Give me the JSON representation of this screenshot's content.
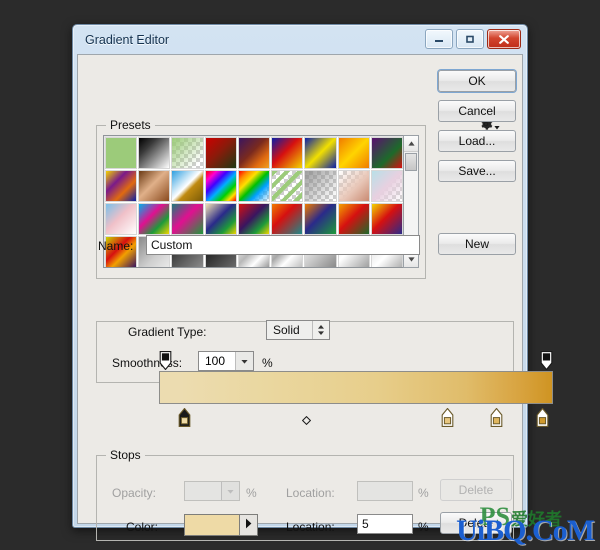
{
  "window": {
    "title": "Gradient Editor",
    "buttons": {
      "minimize": "minimize-button",
      "maximize": "maximize-button",
      "close": "close-button"
    }
  },
  "presets": {
    "legend": "Presets",
    "gear_icon": "gear-icon",
    "scroll": {
      "up": "scroll-up-arrow",
      "down": "scroll-down-arrow"
    },
    "columns": 9,
    "swatches": [
      {
        "name": "green-solid",
        "css": "linear-gradient(135deg,#9ccb7a,#9ccb7a)"
      },
      {
        "name": "black-white",
        "css": "linear-gradient(135deg,#000000 0%,#3a3a3a 30%,#ffffff 100%)"
      },
      {
        "name": "green-transparent",
        "css": "linear-gradient(135deg,#9ccb7a 0%,rgba(156,203,122,0) 85%)",
        "checker": true
      },
      {
        "name": "red-dark-green",
        "css": "linear-gradient(135deg,#cc0000 0%,#8c1a0a 45%,#1d3a14 100%)"
      },
      {
        "name": "purple-orange",
        "css": "linear-gradient(135deg,#3a1560 0%,#7a2a1e 45%,#e06a10 75%,#f0a020 100%)"
      },
      {
        "name": "blue-red-yellow",
        "css": "linear-gradient(135deg,#0a1fa8 0%,#d61010 45%,#f2d400 100%)"
      },
      {
        "name": "blue-yellow",
        "css": "linear-gradient(135deg,#0a1fa8 0%,#f2e000 50%,#0a1fa8 100%)"
      },
      {
        "name": "orange-yellow",
        "css": "linear-gradient(135deg,#f07b00 0%,#ffd400 50%,#f07b00 100%)"
      },
      {
        "name": "purple-green",
        "css": "linear-gradient(135deg,#5a1070 0%,#1d6a2a 60%,#d61010 100%)"
      },
      {
        "name": "yellow-purple-orange",
        "css": "linear-gradient(135deg,#f2d400 0%,#7a1a8a 35%,#e06a10 65%,#0a1fa8 100%)"
      },
      {
        "name": "copper",
        "css": "linear-gradient(135deg,#6b3a14 0%,#e0b089 45%,#8a4a1e 100%)"
      },
      {
        "name": "blue-gold-sky",
        "css": "linear-gradient(135deg,#2f9fe0 0%,#ffffff 48%,#c08a10 60%,#7a5a08 100%)"
      },
      {
        "name": "spectrum",
        "css": "linear-gradient(135deg,#ff0000 0%,#ff00d0 18%,#4000ff 36%,#00b0ff 54%,#00d000 72%,#ffe000 86%,#ff0000 100%)"
      },
      {
        "name": "rainbow-transparent",
        "css": "linear-gradient(135deg,#ff0000 0%,#ff8a00 16%,#ffe000 32%,#00c000 50%,#00a0ff 68%,rgba(120,0,255,0) 100%)",
        "checker": true
      },
      {
        "name": "green-stripes",
        "css": "repeating-linear-gradient(135deg,#9ccb7a 0px,#9ccb7a 4px,rgba(255,255,255,0) 4px,rgba(255,255,255,0) 9px)",
        "checker": true
      },
      {
        "name": "transparent-gray",
        "css": "linear-gradient(135deg,rgba(140,140,140,.85) 0%,rgba(140,140,140,0) 95%)",
        "checker": true
      },
      {
        "name": "pink-transparent",
        "css": "linear-gradient(135deg,rgba(255,255,255,0) 0%,#e8c7b8 55%,#c98a72 100%)",
        "checker": true
      },
      {
        "name": "pastel-transparent",
        "css": "linear-gradient(135deg,#b8e0e8 0%,#e8d0e0 50%,rgba(255,255,255,0) 100%)",
        "checker": true
      },
      {
        "name": "pastel-blue-pink",
        "css": "linear-gradient(135deg,#7ac0e8 0%,#f0c0c8 45%,#ffffff 100%)"
      },
      {
        "name": "cyan-magenta-green",
        "css": "linear-gradient(135deg,#00b0e8 0%,#e01090 40%,#1d9a3a 70%,#f2d400 100%)"
      },
      {
        "name": "teal-magenta",
        "css": "linear-gradient(135deg,#1d7a7a 0%,#e01090 45%,#1d9a3a 100%)"
      },
      {
        "name": "cream-blue-green",
        "css": "linear-gradient(135deg,#f0e0b0 0%,#2a2a8a 45%,#1d9a3a 75%,#f2d400 100%)"
      },
      {
        "name": "red-purple-yellow",
        "css": "linear-gradient(135deg,#d61010 0%,#3a1560 45%,#1d9a3a 75%,#f2d400 100%)"
      },
      {
        "name": "orange-red-teal",
        "css": "linear-gradient(135deg,#f07b00 0%,#d61010 40%,#1d8a8a 100%)"
      },
      {
        "name": "orange-blue-green",
        "css": "linear-gradient(135deg,#f07b00 0%,#2a2a8a 45%,#1d9a3a 100%)"
      },
      {
        "name": "orange-red-green",
        "css": "linear-gradient(135deg,#f2a000 0%,#d61010 45%,#1d6a2a 100%)"
      },
      {
        "name": "yellow-red-blue",
        "css": "linear-gradient(135deg,#f2d400 0%,#d61010 45%,#2a2a8a 100%)"
      },
      {
        "name": "yellow-red-purple",
        "css": "linear-gradient(135deg,#c8d400 0%,#d61010 40%,#f2a000 60%,#3a1560 100%)"
      },
      {
        "name": "gray-light",
        "css": "linear-gradient(135deg,#8a8a8a 0%,#cfcfcf 60%,#e8e8e8 100%)"
      },
      {
        "name": "dark-gray",
        "css": "linear-gradient(135deg,#1a1a1a 0%,#5a5a5a 55%,#8a8a8a 100%)"
      },
      {
        "name": "black-gray",
        "css": "linear-gradient(135deg,#0a0a0a 0%,#3a3a3a 50%,#6a6a6a 100%)"
      },
      {
        "name": "silver-1",
        "css": "linear-gradient(135deg,#ffffff 0%,#b8b8b8 45%,#ffffff 70%,#9a9a9a 100%)"
      },
      {
        "name": "silver-2",
        "css": "linear-gradient(135deg,#f0f0f0 0%,#a8a8a8 40%,#ffffff 65%,#c0c0c0 100%)"
      },
      {
        "name": "silver-3",
        "css": "linear-gradient(135deg,#ffffff 0%,#c8c8c8 50%,#8a8a8a 100%)"
      },
      {
        "name": "silver-4",
        "css": "linear-gradient(135deg,#e8e8e8 0%,#ffffff 40%,#a0a0a0 100%)"
      },
      {
        "name": "silver-5",
        "css": "linear-gradient(135deg,#d8d8d8 0%,#ffffff 55%,#b0b0b0 100%)"
      }
    ]
  },
  "actions": {
    "ok": "OK",
    "cancel": "Cancel",
    "load": "Load...",
    "save": "Save...",
    "new": "New"
  },
  "name_field": {
    "label": "Name:",
    "value": "Custom"
  },
  "gradient_type": {
    "label": "Gradient Type:",
    "value": "Solid"
  },
  "smoothness": {
    "label": "Smoothness:",
    "value": "100",
    "unit": "%"
  },
  "gradient_bar": {
    "css": "linear-gradient(90deg,#ecdcb0 0%,#ecdcb0 5%,#ead79f 28%,#e7ce8b 55%,#e0bc6a 78%,#d8a33f 92%,#cf9422 100%)",
    "opacity_stops": [
      {
        "name": "opacity-stop-start",
        "position": "0",
        "selected": true
      },
      {
        "name": "opacity-stop-end",
        "position": "100",
        "selected": true
      }
    ],
    "color_stops": [
      {
        "name": "color-stop-1",
        "position": "5",
        "color": "#eedaa6",
        "selected": true
      },
      {
        "name": "color-stop-2",
        "position": "74",
        "color": "#e8c77f",
        "selected": false
      },
      {
        "name": "color-stop-3",
        "position": "87",
        "color": "#e0b75f",
        "selected": false
      },
      {
        "name": "color-stop-4",
        "position": "99",
        "color": "#d09a2e",
        "selected": false
      }
    ],
    "midpoint": {
      "name": "midpoint-diamond",
      "position": "37"
    }
  },
  "stops": {
    "legend": "Stops",
    "opacity": {
      "label": "Opacity:",
      "value": "",
      "unit": "%",
      "location_label": "Location:",
      "location_value": "",
      "location_unit": "%",
      "delete_label": "Delete",
      "enabled": false
    },
    "color": {
      "label": "Color:",
      "swatch": "#eedaa6",
      "location_label": "Location:",
      "location_value": "5",
      "location_unit": "%",
      "delete_label": "Delete",
      "enabled": true
    }
  },
  "watermark": {
    "text": "UiBQ.CoM",
    "ps": "PS",
    "cn": "爱好者"
  },
  "colors": {
    "dialog_frame": "#cadcee",
    "client_bg": "#eceae6",
    "close_red": "#d2452e",
    "desktop": "#2b2b2b"
  }
}
